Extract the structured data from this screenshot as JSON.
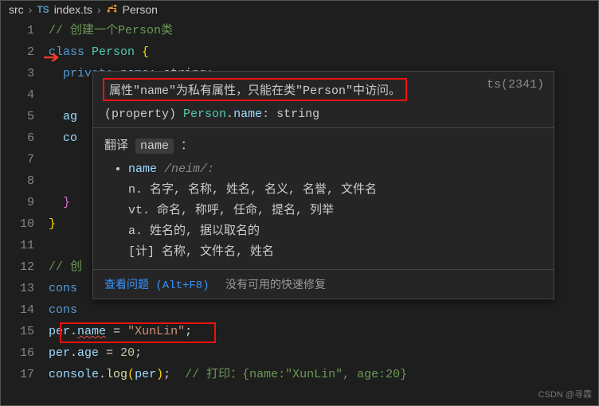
{
  "breadcrumb": {
    "folder": "src",
    "ts_label": "TS",
    "file": "index.ts",
    "symbol": "Person"
  },
  "lines": {
    "l1_comment": "// 创建一个Person类",
    "l2": {
      "kw": "class ",
      "type": "Person ",
      "brace": "{"
    },
    "l3": {
      "kw": "private ",
      "prop": "name",
      "rest": ": string;"
    },
    "l5_frag": "ag",
    "l6_frag": "co",
    "l12_comment": "// 创",
    "l13_frag": "cons",
    "l14_frag": "cons",
    "l15": {
      "obj": "per",
      "dot": ".",
      "prop": "name",
      "eq": " = ",
      "str": "\"XunLin\"",
      "semi": ";"
    },
    "l16": {
      "obj": "per",
      "dot": ".",
      "prop": "age",
      "eq": " = ",
      "num": "20",
      "semi": ";"
    },
    "l17": {
      "obj": "console",
      "dot": ".",
      "fn": "log",
      "lp": "(",
      "arg": "per",
      "rp": ")",
      "semi": ";",
      "comment": "  // 打印：{name:\"XunLin\", age:20}"
    }
  },
  "line_numbers": [
    "1",
    "2",
    "3",
    "4",
    "5",
    "6",
    "7",
    "8",
    "9",
    "10",
    "11",
    "12",
    "13",
    "14",
    "15",
    "16",
    "17"
  ],
  "tooltip": {
    "error_msg": "属性\"name\"为私有属性，只能在类\"Person\"中访问。",
    "error_code": "ts(2341)",
    "signature_pre": "(property) ",
    "signature_type": "Person",
    "signature_dot": ".",
    "signature_prop": "name",
    "signature_rest": ": string",
    "translate_label": "翻译",
    "translate_word": "name",
    "translate_colon": " ：",
    "dict_word": "name",
    "pronunciation": " /neim/:",
    "def1": "n. 名字, 名称, 姓名, 名义, 名誉, 文件名",
    "def2": "vt. 命名, 称呼, 任命, 提名, 列举",
    "def3": "a. 姓名的, 据以取名的",
    "def4": "[计] 名称, 文件名, 姓名",
    "view_problem": "查看问题 (Alt+F8)",
    "no_fix": "没有可用的快速修复"
  },
  "watermark": "CSDN @寻霖"
}
